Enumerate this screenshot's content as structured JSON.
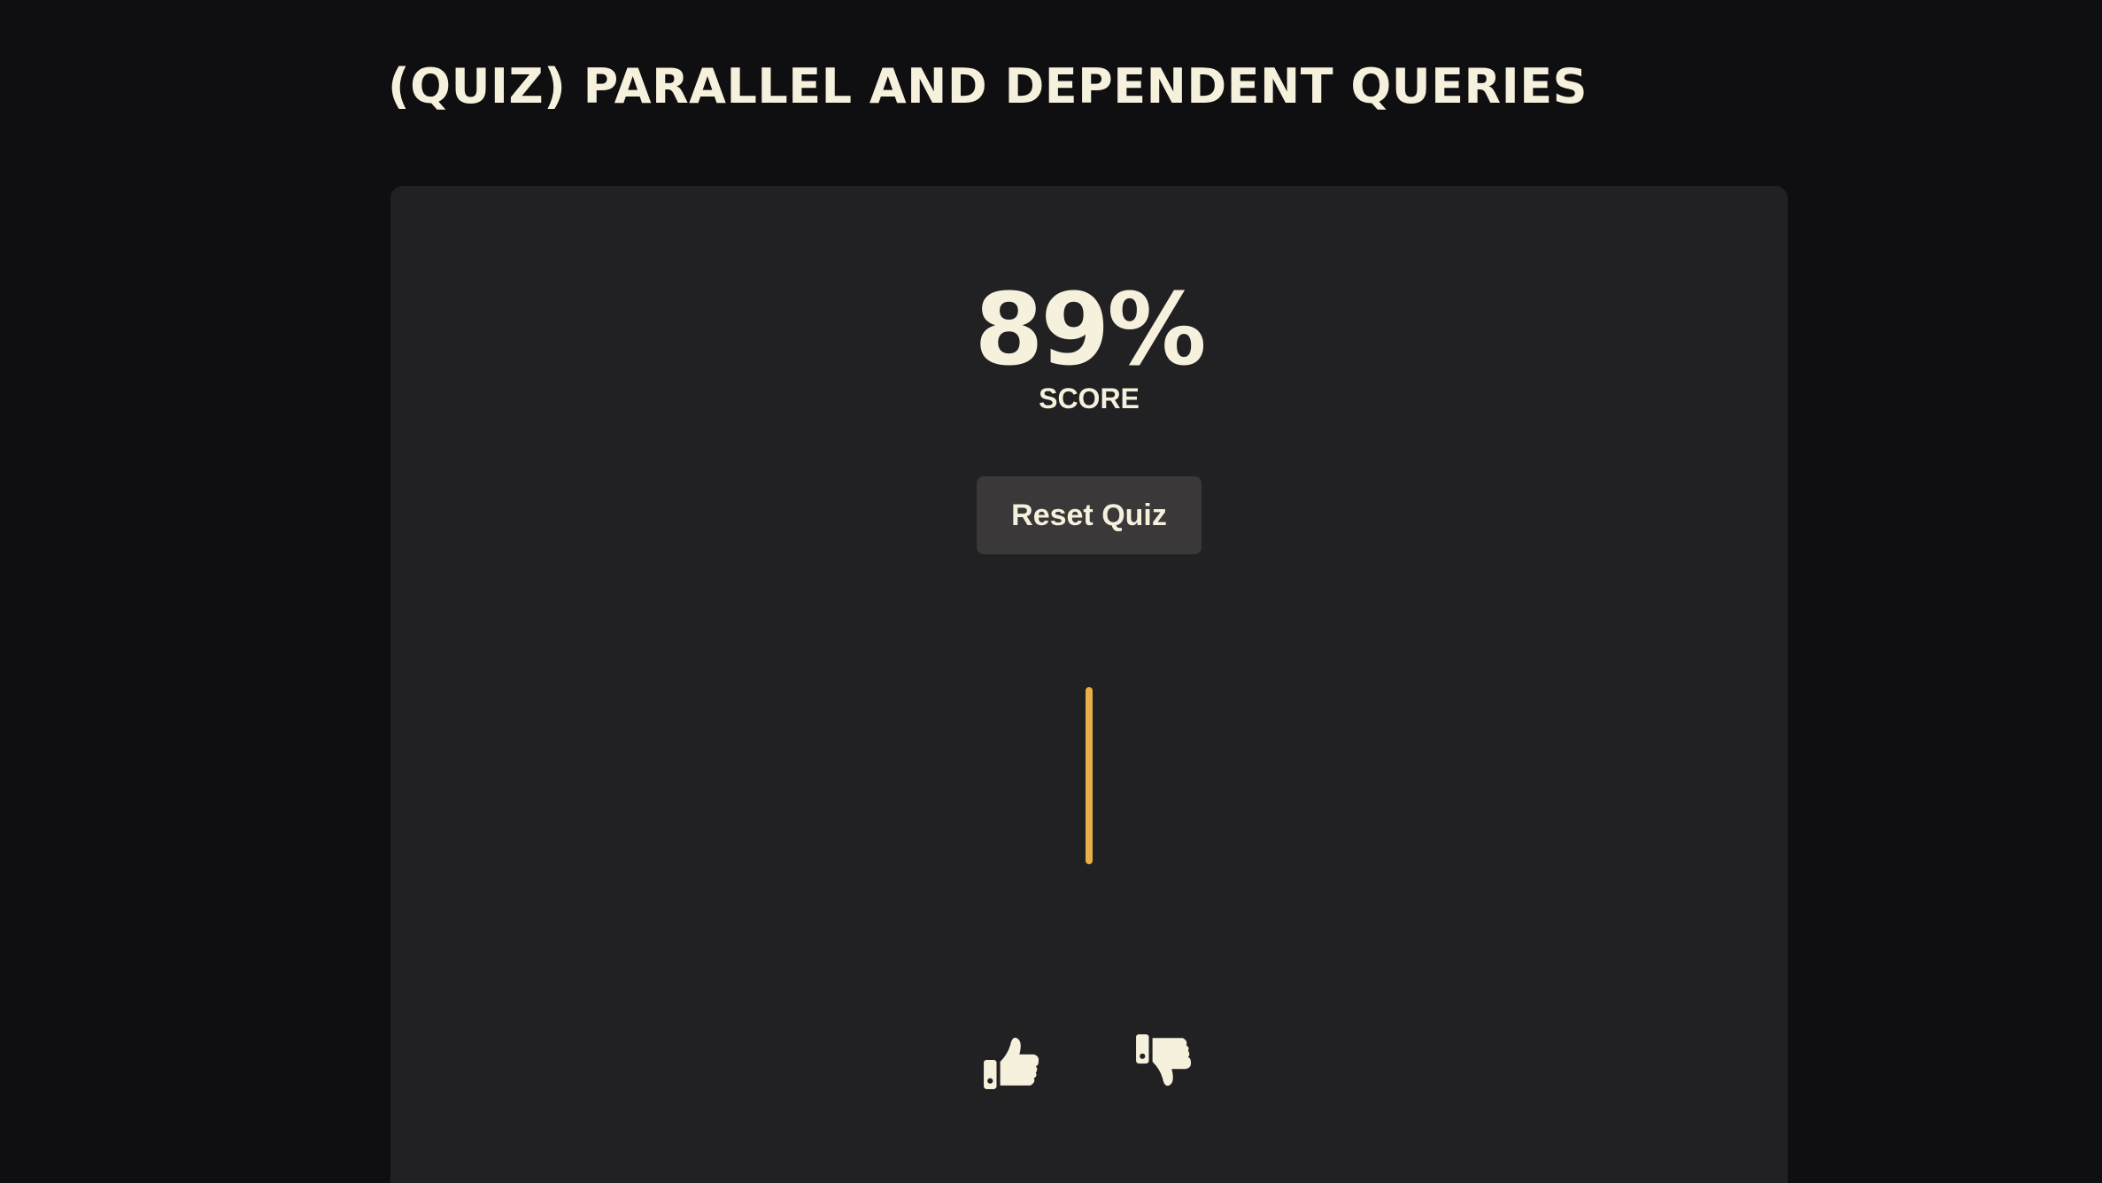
{
  "page": {
    "title": "(QUIZ) PARALLEL AND DEPENDENT QUERIES"
  },
  "result": {
    "score": "89%",
    "score_label": "SCORE"
  },
  "actions": {
    "reset_label": "Reset Quiz"
  },
  "feedback": {
    "like_icon": "thumbs-up-icon",
    "dislike_icon": "thumbs-down-icon"
  },
  "colors": {
    "background": "#0f0e10",
    "card": "#212022",
    "text": "#f6f1dd",
    "button": "#3a3839",
    "accent": "#e9b04a"
  }
}
